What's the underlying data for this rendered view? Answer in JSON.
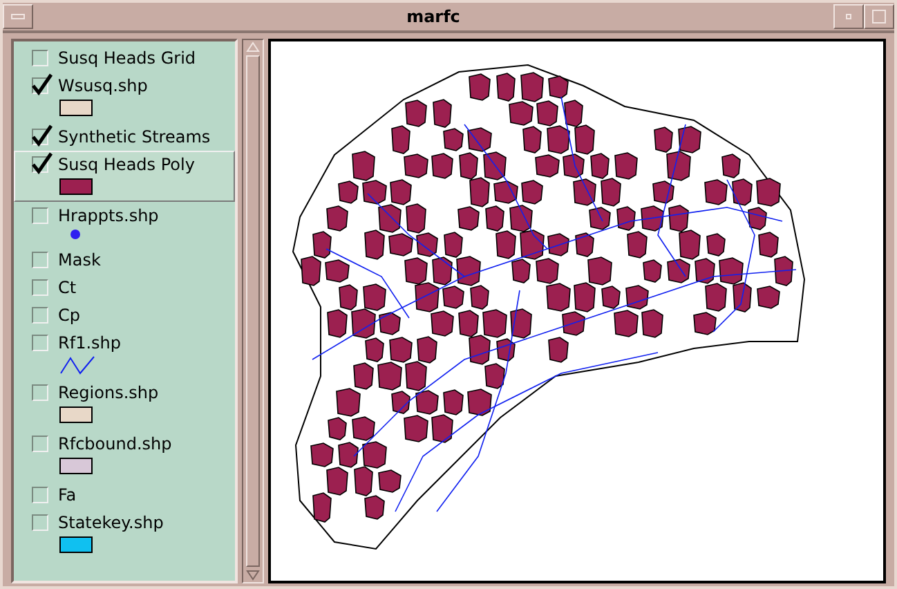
{
  "window": {
    "title": "marfc"
  },
  "layers": [
    {
      "name": "Susq Heads Grid",
      "checked": false,
      "selected": false,
      "kind": "none"
    },
    {
      "name": "Wsusq.shp",
      "checked": true,
      "selected": false,
      "kind": "fill",
      "color": "#e8d8c8"
    },
    {
      "name": "Synthetic Streams",
      "checked": true,
      "selected": false,
      "kind": "none"
    },
    {
      "name": "Susq Heads Poly",
      "checked": true,
      "selected": true,
      "kind": "fill",
      "color": "#9c2050"
    },
    {
      "name": "Hrappts.shp",
      "checked": false,
      "selected": false,
      "kind": "point",
      "color": "#3020f0"
    },
    {
      "name": "Mask",
      "checked": false,
      "selected": false,
      "kind": "none"
    },
    {
      "name": "Ct",
      "checked": false,
      "selected": false,
      "kind": "none"
    },
    {
      "name": "Cp",
      "checked": false,
      "selected": false,
      "kind": "none"
    },
    {
      "name": "Rf1.shp",
      "checked": false,
      "selected": false,
      "kind": "line",
      "color": "#1020f0"
    },
    {
      "name": "Regions.shp",
      "checked": false,
      "selected": false,
      "kind": "fill",
      "color": "#e8d8c8"
    },
    {
      "name": "Rfcbound.shp",
      "checked": false,
      "selected": false,
      "kind": "fill",
      "color": "#d8c8d8"
    },
    {
      "name": "Fa",
      "checked": false,
      "selected": false,
      "kind": "none"
    },
    {
      "name": "Statekey.shp",
      "checked": false,
      "selected": false,
      "kind": "fill",
      "color": "#10c0f0"
    }
  ]
}
